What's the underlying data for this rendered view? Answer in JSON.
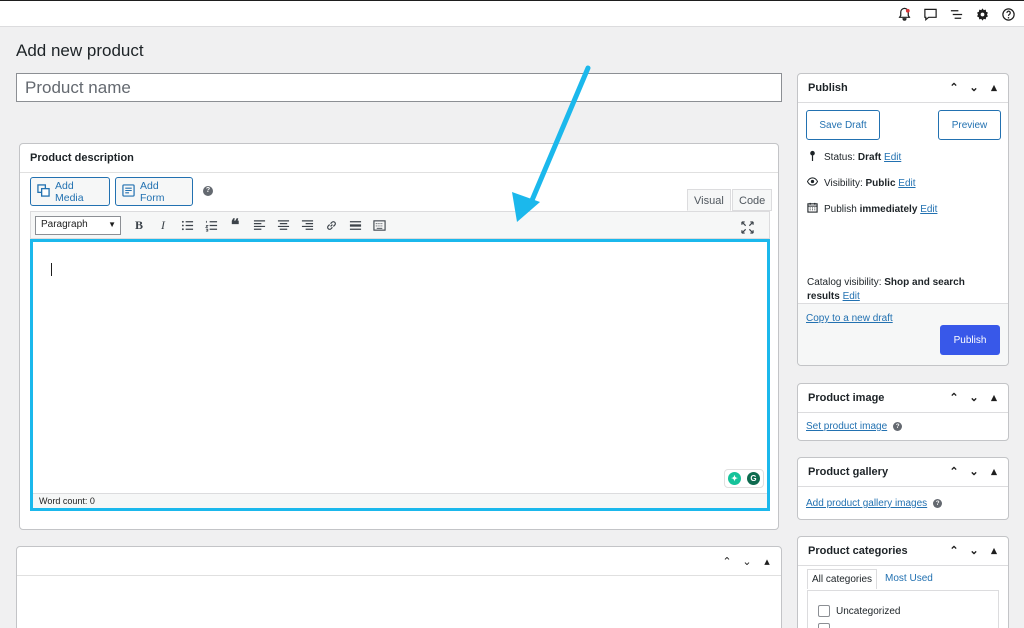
{
  "topbar": {
    "icons": [
      "notifications-icon",
      "comment-icon",
      "list-icon",
      "gear-icon",
      "help-icon"
    ]
  },
  "page": {
    "title": "Add new product"
  },
  "product_name": {
    "placeholder": "Product name",
    "value": ""
  },
  "description": {
    "heading": "Product description",
    "add_media": "Add Media",
    "add_form": "Add Form",
    "tab_visual": "Visual",
    "tab_code": "Code",
    "format_select": "Paragraph",
    "word_count": "Word count: 0"
  },
  "publish": {
    "heading": "Publish",
    "save_draft": "Save Draft",
    "preview": "Preview",
    "status_label": "Status:",
    "status_value": "Draft",
    "visibility_label": "Visibility:",
    "visibility_value": "Public",
    "publish_label": "Publish",
    "publish_value": "immediately",
    "edit": "Edit",
    "catalog_label": "Catalog visibility:",
    "catalog_value": "Shop and search",
    "catalog_value_2": "results",
    "copy_draft": "Copy to a new draft",
    "publish_button": "Publish"
  },
  "product_image": {
    "heading": "Product image",
    "link": "Set product image"
  },
  "product_gallery": {
    "heading": "Product gallery",
    "link": "Add product gallery images"
  },
  "product_categories": {
    "heading": "Product categories",
    "tab_all": "All categories",
    "tab_most_used": "Most Used",
    "items": [
      "Uncategorized"
    ]
  },
  "colors": {
    "highlight": "#1bb8ec",
    "primary": "#3858e9",
    "link": "#2271b1"
  }
}
